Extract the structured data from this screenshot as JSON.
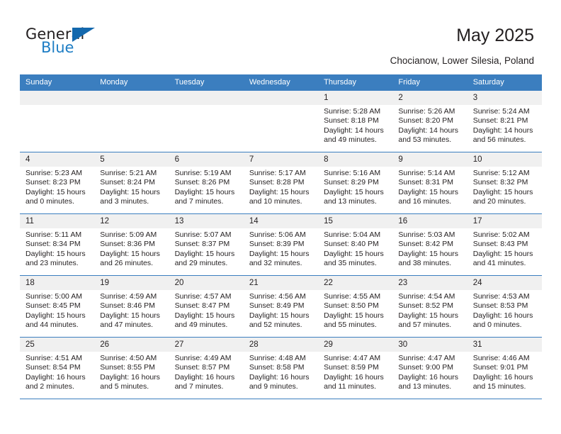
{
  "brand": {
    "name_dark": "General",
    "name_blue": "Blue",
    "accent_color": "#1368ad",
    "blue_text_color": "#1d7dc4"
  },
  "header": {
    "title": "May 2025",
    "location": "Chocianow, Lower Silesia, Poland",
    "header_bg_color": "#3b7ebf",
    "daynum_bg_color": "#f0f0f0"
  },
  "weekday_headers": [
    "Sunday",
    "Monday",
    "Tuesday",
    "Wednesday",
    "Thursday",
    "Friday",
    "Saturday"
  ],
  "weeks": [
    [
      {
        "day": "",
        "sunrise": "",
        "sunset": "",
        "daylight_line1": "",
        "daylight_line2": ""
      },
      {
        "day": "",
        "sunrise": "",
        "sunset": "",
        "daylight_line1": "",
        "daylight_line2": ""
      },
      {
        "day": "",
        "sunrise": "",
        "sunset": "",
        "daylight_line1": "",
        "daylight_line2": ""
      },
      {
        "day": "",
        "sunrise": "",
        "sunset": "",
        "daylight_line1": "",
        "daylight_line2": ""
      },
      {
        "day": "1",
        "sunrise": "Sunrise: 5:28 AM",
        "sunset": "Sunset: 8:18 PM",
        "daylight_line1": "Daylight: 14 hours",
        "daylight_line2": "and 49 minutes."
      },
      {
        "day": "2",
        "sunrise": "Sunrise: 5:26 AM",
        "sunset": "Sunset: 8:20 PM",
        "daylight_line1": "Daylight: 14 hours",
        "daylight_line2": "and 53 minutes."
      },
      {
        "day": "3",
        "sunrise": "Sunrise: 5:24 AM",
        "sunset": "Sunset: 8:21 PM",
        "daylight_line1": "Daylight: 14 hours",
        "daylight_line2": "and 56 minutes."
      }
    ],
    [
      {
        "day": "4",
        "sunrise": "Sunrise: 5:23 AM",
        "sunset": "Sunset: 8:23 PM",
        "daylight_line1": "Daylight: 15 hours",
        "daylight_line2": "and 0 minutes."
      },
      {
        "day": "5",
        "sunrise": "Sunrise: 5:21 AM",
        "sunset": "Sunset: 8:24 PM",
        "daylight_line1": "Daylight: 15 hours",
        "daylight_line2": "and 3 minutes."
      },
      {
        "day": "6",
        "sunrise": "Sunrise: 5:19 AM",
        "sunset": "Sunset: 8:26 PM",
        "daylight_line1": "Daylight: 15 hours",
        "daylight_line2": "and 7 minutes."
      },
      {
        "day": "7",
        "sunrise": "Sunrise: 5:17 AM",
        "sunset": "Sunset: 8:28 PM",
        "daylight_line1": "Daylight: 15 hours",
        "daylight_line2": "and 10 minutes."
      },
      {
        "day": "8",
        "sunrise": "Sunrise: 5:16 AM",
        "sunset": "Sunset: 8:29 PM",
        "daylight_line1": "Daylight: 15 hours",
        "daylight_line2": "and 13 minutes."
      },
      {
        "day": "9",
        "sunrise": "Sunrise: 5:14 AM",
        "sunset": "Sunset: 8:31 PM",
        "daylight_line1": "Daylight: 15 hours",
        "daylight_line2": "and 16 minutes."
      },
      {
        "day": "10",
        "sunrise": "Sunrise: 5:12 AM",
        "sunset": "Sunset: 8:32 PM",
        "daylight_line1": "Daylight: 15 hours",
        "daylight_line2": "and 20 minutes."
      }
    ],
    [
      {
        "day": "11",
        "sunrise": "Sunrise: 5:11 AM",
        "sunset": "Sunset: 8:34 PM",
        "daylight_line1": "Daylight: 15 hours",
        "daylight_line2": "and 23 minutes."
      },
      {
        "day": "12",
        "sunrise": "Sunrise: 5:09 AM",
        "sunset": "Sunset: 8:36 PM",
        "daylight_line1": "Daylight: 15 hours",
        "daylight_line2": "and 26 minutes."
      },
      {
        "day": "13",
        "sunrise": "Sunrise: 5:07 AM",
        "sunset": "Sunset: 8:37 PM",
        "daylight_line1": "Daylight: 15 hours",
        "daylight_line2": "and 29 minutes."
      },
      {
        "day": "14",
        "sunrise": "Sunrise: 5:06 AM",
        "sunset": "Sunset: 8:39 PM",
        "daylight_line1": "Daylight: 15 hours",
        "daylight_line2": "and 32 minutes."
      },
      {
        "day": "15",
        "sunrise": "Sunrise: 5:04 AM",
        "sunset": "Sunset: 8:40 PM",
        "daylight_line1": "Daylight: 15 hours",
        "daylight_line2": "and 35 minutes."
      },
      {
        "day": "16",
        "sunrise": "Sunrise: 5:03 AM",
        "sunset": "Sunset: 8:42 PM",
        "daylight_line1": "Daylight: 15 hours",
        "daylight_line2": "and 38 minutes."
      },
      {
        "day": "17",
        "sunrise": "Sunrise: 5:02 AM",
        "sunset": "Sunset: 8:43 PM",
        "daylight_line1": "Daylight: 15 hours",
        "daylight_line2": "and 41 minutes."
      }
    ],
    [
      {
        "day": "18",
        "sunrise": "Sunrise: 5:00 AM",
        "sunset": "Sunset: 8:45 PM",
        "daylight_line1": "Daylight: 15 hours",
        "daylight_line2": "and 44 minutes."
      },
      {
        "day": "19",
        "sunrise": "Sunrise: 4:59 AM",
        "sunset": "Sunset: 8:46 PM",
        "daylight_line1": "Daylight: 15 hours",
        "daylight_line2": "and 47 minutes."
      },
      {
        "day": "20",
        "sunrise": "Sunrise: 4:57 AM",
        "sunset": "Sunset: 8:47 PM",
        "daylight_line1": "Daylight: 15 hours",
        "daylight_line2": "and 49 minutes."
      },
      {
        "day": "21",
        "sunrise": "Sunrise: 4:56 AM",
        "sunset": "Sunset: 8:49 PM",
        "daylight_line1": "Daylight: 15 hours",
        "daylight_line2": "and 52 minutes."
      },
      {
        "day": "22",
        "sunrise": "Sunrise: 4:55 AM",
        "sunset": "Sunset: 8:50 PM",
        "daylight_line1": "Daylight: 15 hours",
        "daylight_line2": "and 55 minutes."
      },
      {
        "day": "23",
        "sunrise": "Sunrise: 4:54 AM",
        "sunset": "Sunset: 8:52 PM",
        "daylight_line1": "Daylight: 15 hours",
        "daylight_line2": "and 57 minutes."
      },
      {
        "day": "24",
        "sunrise": "Sunrise: 4:53 AM",
        "sunset": "Sunset: 8:53 PM",
        "daylight_line1": "Daylight: 16 hours",
        "daylight_line2": "and 0 minutes."
      }
    ],
    [
      {
        "day": "25",
        "sunrise": "Sunrise: 4:51 AM",
        "sunset": "Sunset: 8:54 PM",
        "daylight_line1": "Daylight: 16 hours",
        "daylight_line2": "and 2 minutes."
      },
      {
        "day": "26",
        "sunrise": "Sunrise: 4:50 AM",
        "sunset": "Sunset: 8:55 PM",
        "daylight_line1": "Daylight: 16 hours",
        "daylight_line2": "and 5 minutes."
      },
      {
        "day": "27",
        "sunrise": "Sunrise: 4:49 AM",
        "sunset": "Sunset: 8:57 PM",
        "daylight_line1": "Daylight: 16 hours",
        "daylight_line2": "and 7 minutes."
      },
      {
        "day": "28",
        "sunrise": "Sunrise: 4:48 AM",
        "sunset": "Sunset: 8:58 PM",
        "daylight_line1": "Daylight: 16 hours",
        "daylight_line2": "and 9 minutes."
      },
      {
        "day": "29",
        "sunrise": "Sunrise: 4:47 AM",
        "sunset": "Sunset: 8:59 PM",
        "daylight_line1": "Daylight: 16 hours",
        "daylight_line2": "and 11 minutes."
      },
      {
        "day": "30",
        "sunrise": "Sunrise: 4:47 AM",
        "sunset": "Sunset: 9:00 PM",
        "daylight_line1": "Daylight: 16 hours",
        "daylight_line2": "and 13 minutes."
      },
      {
        "day": "31",
        "sunrise": "Sunrise: 4:46 AM",
        "sunset": "Sunset: 9:01 PM",
        "daylight_line1": "Daylight: 16 hours",
        "daylight_line2": "and 15 minutes."
      }
    ]
  ]
}
